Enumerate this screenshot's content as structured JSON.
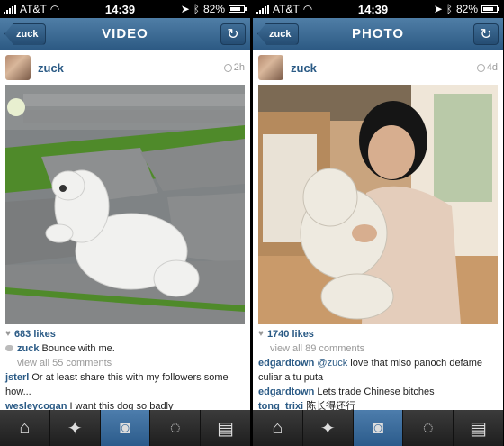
{
  "status_bar": {
    "carrier": "AT&T",
    "time": "14:39",
    "battery": "82%"
  },
  "screens": [
    {
      "nav": {
        "back": "zuck",
        "title": "VIDEO"
      },
      "post": {
        "username": "zuck",
        "time_ago": "2h",
        "likes": "683 likes",
        "caption_user": "zuck",
        "caption_text": "Bounce with me.",
        "view_all": "view all 55 comments",
        "comments": [
          {
            "user": "jsterl",
            "text": "Or at least share this with my followers some how..."
          },
          {
            "user": "wesleycogan",
            "text": "I want this dog so badly"
          }
        ]
      }
    },
    {
      "nav": {
        "back": "zuck",
        "title": "PHOTO"
      },
      "post": {
        "username": "zuck",
        "time_ago": "4d",
        "likes": "1740 likes",
        "view_all": "view all 89 comments",
        "comments": [
          {
            "user": "edgardtown",
            "mention": "@zuck",
            "text": " love that miso panoch defame culiar  a tu puta"
          },
          {
            "user": "edgardtown",
            "text": "Lets trade Chinese bitches"
          },
          {
            "user": "tong_trixi",
            "text": "陈长得还行"
          }
        ]
      }
    }
  ],
  "tabbar": [
    "home-icon",
    "explore-icon",
    "camera-icon",
    "news-icon",
    "profile-icon"
  ]
}
